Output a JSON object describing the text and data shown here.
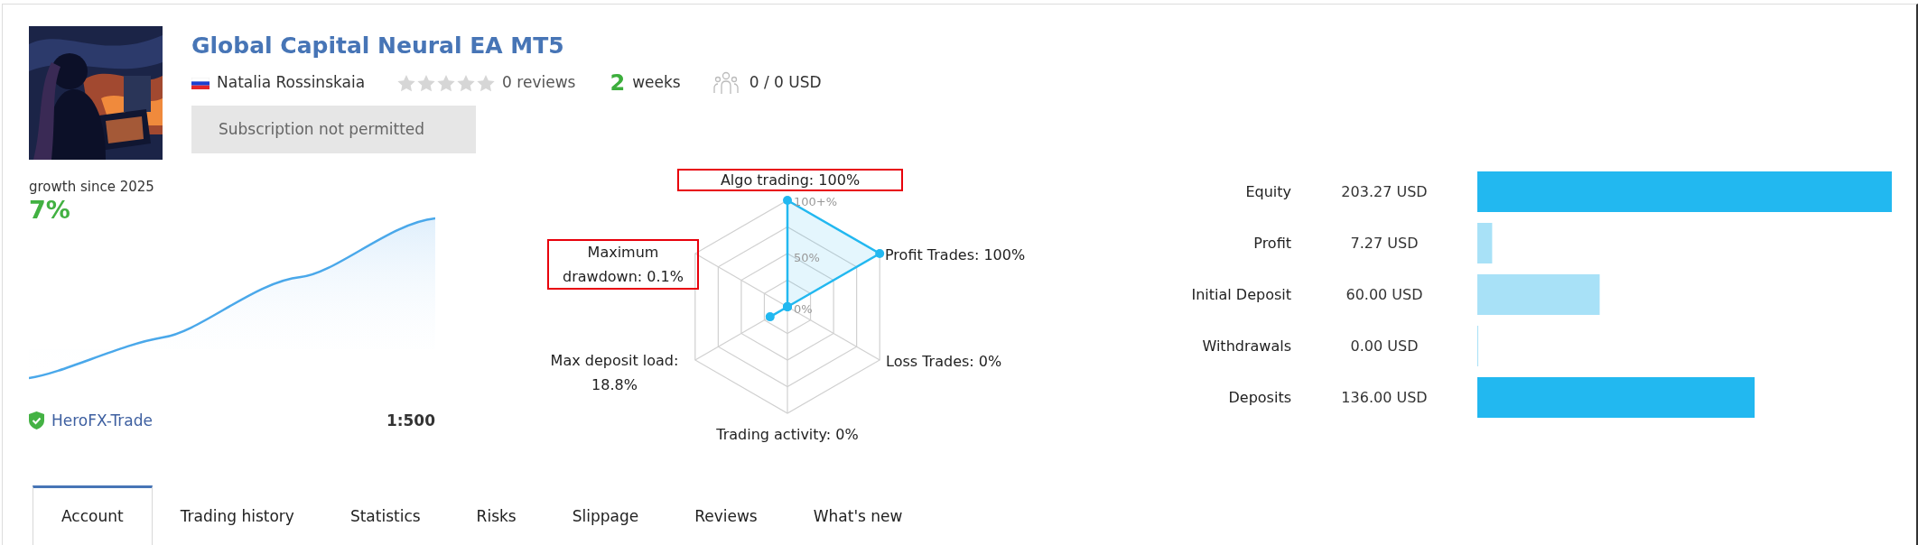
{
  "product": {
    "title": "Global Capital Neural EA MT5",
    "author": "Natalia Rossinskaia",
    "stars": 0,
    "reviews": "0 reviews",
    "age_number": "2",
    "age_unit": "weeks",
    "subscribers": "0 / 0 USD",
    "button": {
      "label": "Subscription not permitted",
      "disabled": true
    }
  },
  "growth": {
    "caption": "growth since 2025",
    "value": "7%",
    "broker": "HeroFX-Trade",
    "verified": true,
    "leverage": "1:500"
  },
  "radar": {
    "ticks": [
      "100+%",
      "50%",
      "0%"
    ],
    "axes": [
      {
        "label": "Algo trading: 100%",
        "highlighted": true
      },
      {
        "label": "Maximum drawdown: 0.1%",
        "highlighted": true
      },
      {
        "label": "Profit Trades: 100%",
        "highlighted": false
      },
      {
        "label": "Max deposit load: 18.8%",
        "highlighted": false
      },
      {
        "label": "Loss Trades: 0%",
        "highlighted": false
      },
      {
        "label": "Trading activity: 0%",
        "highlighted": false
      }
    ]
  },
  "balances": {
    "bars": [
      {
        "color": "#22b8f0"
      },
      {
        "color": "#a8e1f7"
      },
      {
        "color": "#a8e1f7"
      },
      {
        "color": "#a8e1f7"
      },
      {
        "color": "#22b8f0"
      }
    ],
    "chart_data": {
      "type": "bar",
      "orientation": "horizontal",
      "categories": [
        "Equity",
        "Profit",
        "Initial Deposit",
        "Withdrawals",
        "Deposits"
      ],
      "values": [
        203.27,
        7.27,
        60.0,
        0.0,
        136.0
      ],
      "value_labels": [
        "203.27 USD",
        "7.27 USD",
        "60.00 USD",
        "0.00 USD",
        "136.00 USD"
      ]
    }
  },
  "tabs": [
    {
      "label": "Account",
      "selected": true
    },
    {
      "label": "Trading history",
      "selected": false
    },
    {
      "label": "Statistics",
      "selected": false
    },
    {
      "label": "Risks",
      "selected": false
    },
    {
      "label": "Slippage",
      "selected": false
    },
    {
      "label": "Reviews",
      "selected": false
    },
    {
      "label": "What's new",
      "selected": false
    }
  ]
}
